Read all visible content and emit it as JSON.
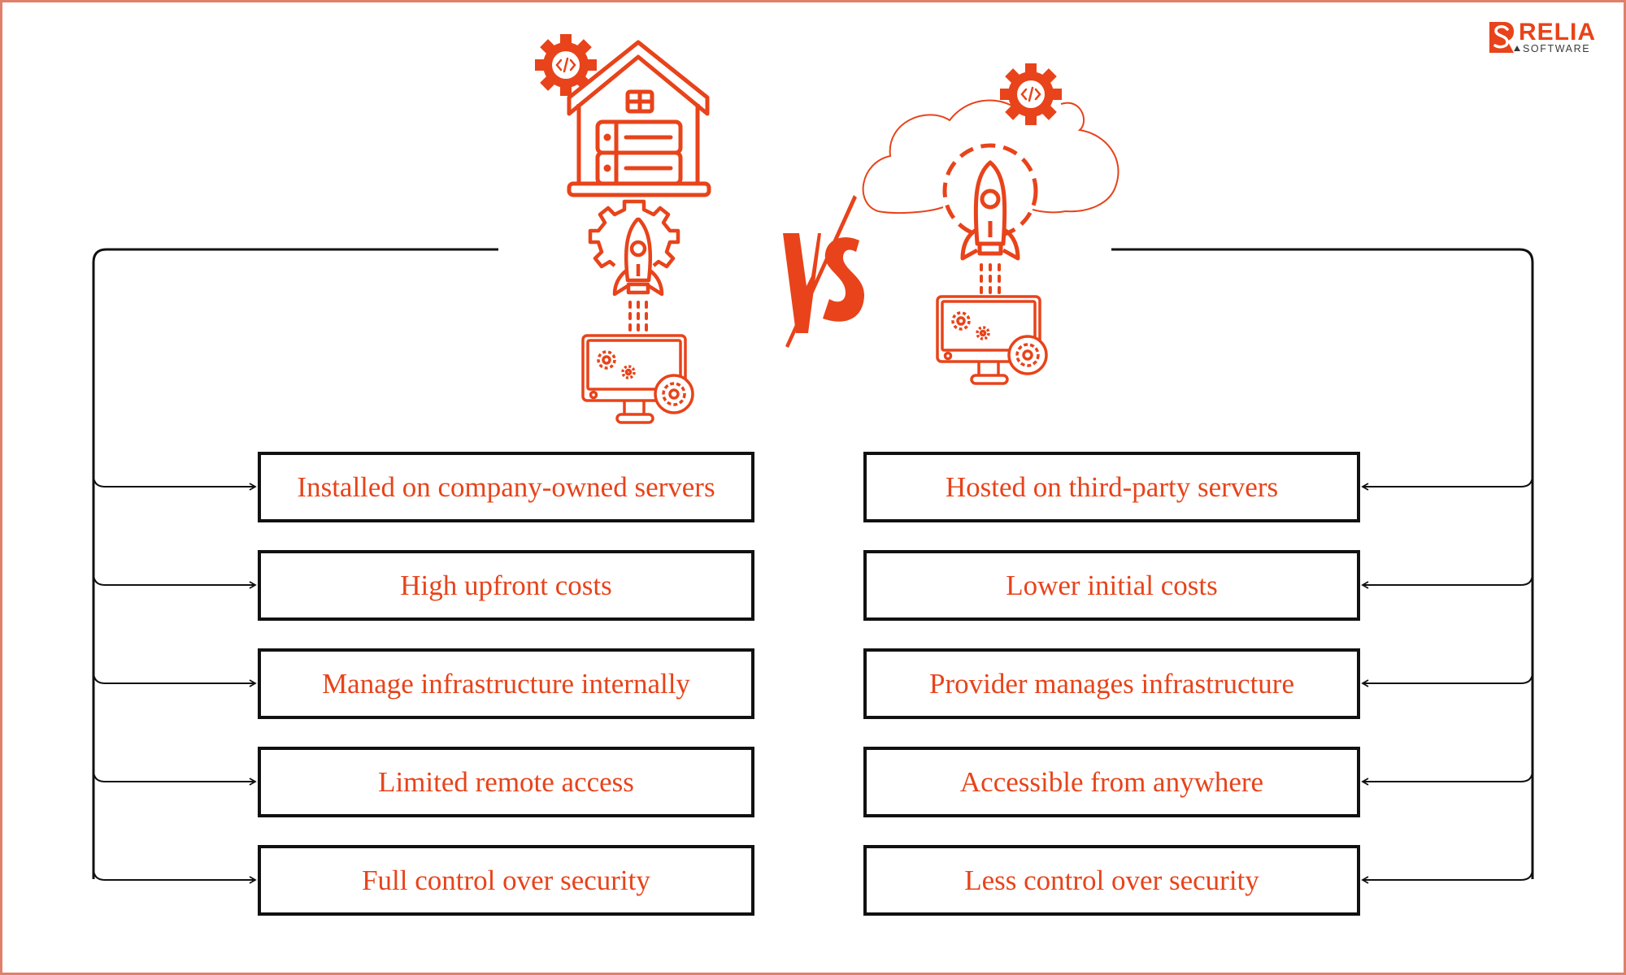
{
  "logo": {
    "name": "RELIA",
    "sub": "SOFTWARE"
  },
  "colors": {
    "accent": "#E8431A",
    "frame": "#E0806A",
    "line": "#111111"
  },
  "center": {
    "vs_label": "VS"
  },
  "left": {
    "concept": "On-premise",
    "icons": [
      "code-gear-icon",
      "house-server-icon",
      "rocket-gear-icon",
      "monitor-gears-icon"
    ],
    "items": [
      "Installed on company-owned servers",
      "High upfront costs",
      "Manage infrastructure internally",
      "Limited remote access",
      "Full control over security"
    ]
  },
  "right": {
    "concept": "Cloud",
    "icons": [
      "code-gear-icon",
      "cloud-icon",
      "rocket-gear-icon",
      "monitor-gears-icon"
    ],
    "items": [
      "Hosted on third-party servers",
      "Lower initial costs",
      "Provider manages infrastructure",
      "Accessible from anywhere",
      "Less control over security"
    ]
  }
}
